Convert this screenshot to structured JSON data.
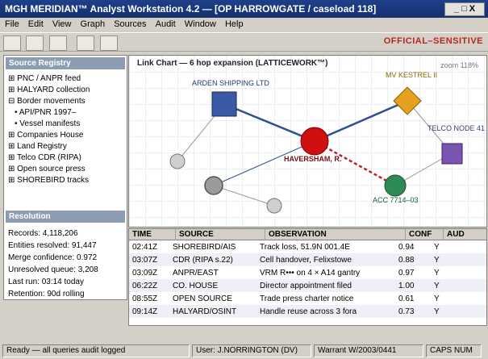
{
  "window": {
    "title": "MGH MERIDIAN™ Analyst Workstation 4.2 — [OP HARROWGATE / caseload 118]",
    "controls": "_ □ X"
  },
  "menu": [
    "File",
    "Edit",
    "View",
    "Graph",
    "Sources",
    "Audit",
    "Window",
    "Help"
  ],
  "toolbar": {
    "classification": "OFFICIAL–SENSITIVE"
  },
  "registry": {
    "heading": "Source Registry",
    "items": [
      "⊞ PNC / ANPR feed",
      "⊞ HALYARD collection",
      "⊟ Border movements",
      "• API/PNR 1997–",
      "• Vessel manifests",
      "⊞ Companies House",
      "⊞ Land Registry",
      "⊞ Telco CDR (RIPA)",
      "⊞ Open source press",
      "⊞ SHOREBIRD tracks"
    ]
  },
  "resolution": {
    "heading": "Resolution",
    "stats": [
      "Records: 4,118,206",
      "Entities resolved: 91,447",
      "Merge confidence: 0.972",
      "Unresolved queue: 3,208",
      "Last run: 03:14 today",
      "Retention: 90d rolling"
    ]
  },
  "graph": {
    "title": "Link Chart — 6 hop expansion (LATTICEWORK™)",
    "zoom": "zoom 118%",
    "labels": {
      "arden": "ARDEN SHIPPING LTD",
      "kestrel": "MV KESTREL II",
      "telco": "TELCO NODE 41",
      "haversham": "HAVERSHAM, R.",
      "acc": "ACC 7714–03"
    },
    "colors": {
      "company": "#3a5aa6",
      "vessel": "#e6a020",
      "telco": "#7a55b0",
      "person": "#d01010",
      "account": "#2e8b57",
      "unknown": "#9a9a9a",
      "link": "#2f4f8f",
      "suspect_link": "#c02020"
    }
  },
  "table": {
    "columns": [
      "TIME",
      "SOURCE",
      "OBSERVATION",
      "CONF",
      "AUD"
    ],
    "rows": [
      [
        "02:41Z",
        "SHOREBIRD/AIS",
        "Track loss, 51.9N 001.4E",
        "0.94",
        "Y"
      ],
      [
        "03:07Z",
        "CDR (RIPA s.22)",
        "Cell handover, Felixstowe",
        "0.88",
        "Y"
      ],
      [
        "03:09Z",
        "ANPR/EAST",
        "VRM R••• on 4 × A14 gantry",
        "0.97",
        "Y"
      ],
      [
        "06:22Z",
        "CO. HOUSE",
        "Director appointment filed",
        "1.00",
        "Y"
      ],
      [
        "08:55Z",
        "OPEN SOURCE",
        "Trade press charter notice",
        "0.61",
        "Y"
      ],
      [
        "09:14Z",
        "HALYARD/OSINT",
        "Handle reuse across 3 fora",
        "0.73",
        "Y"
      ]
    ]
  },
  "status": {
    "ready": "Ready — all queries audit logged",
    "user": "User: J.NORRINGTON (DV)",
    "warrant": "Warrant W/2003/0441",
    "keys": "CAPS NUM"
  }
}
